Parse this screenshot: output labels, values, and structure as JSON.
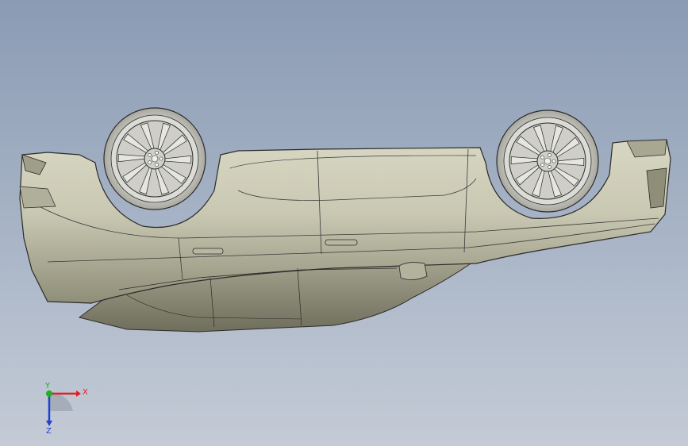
{
  "viewport": {
    "background_top": "#8b9bb4",
    "background_bottom": "#c4cbd6",
    "model_fill": "#c9c8b2",
    "model_shade": "#8f8e78",
    "model_edge": "#2b2b2b"
  },
  "model": {
    "name": "inverted-car-body",
    "wheels": 2,
    "spokes_per_wheel": 10
  },
  "triad": {
    "x_label": "X",
    "y_label": "Y",
    "z_label": "Z",
    "x_color": "#e02020",
    "y_color": "#20b020",
    "z_color": "#2040d0"
  }
}
